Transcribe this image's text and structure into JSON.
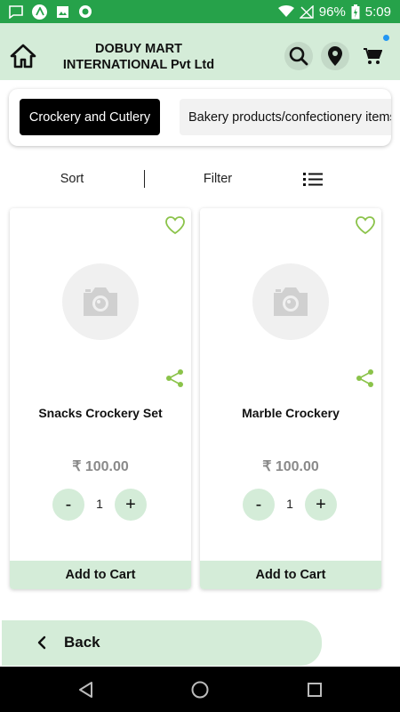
{
  "status_bar": {
    "battery": "96%",
    "time": "5:09",
    "icons": [
      "message-icon",
      "app-a-icon",
      "image-icon",
      "record-icon",
      "wifi-icon",
      "no-signal-icon",
      "battery-charging-icon"
    ],
    "color": "#26a24a"
  },
  "header": {
    "title_line1": "DOBUY MART",
    "title_line2": "INTERNATIONAL Pvt Ltd",
    "background": "#d4ecd8"
  },
  "categories": {
    "active": "Crockery and Cutlery",
    "inactive": "Bakery products/confectionery items"
  },
  "toolbar": {
    "sort_label": "Sort",
    "filter_label": "Filter"
  },
  "products": [
    {
      "name": "Snacks Crockery Set",
      "price": "₹ 100.00",
      "qty": "1",
      "minus": "-",
      "plus": "+",
      "add_label": "Add to Cart"
    },
    {
      "name": "Marble Crockery",
      "price": "₹ 100.00",
      "qty": "1",
      "minus": "-",
      "plus": "+",
      "add_label": "Add to Cart"
    }
  ],
  "back": {
    "label": "Back"
  },
  "colors": {
    "accent_light": "#d4ecd8",
    "wish_green": "#8bc34a",
    "cart_badge": "#2196f3"
  }
}
